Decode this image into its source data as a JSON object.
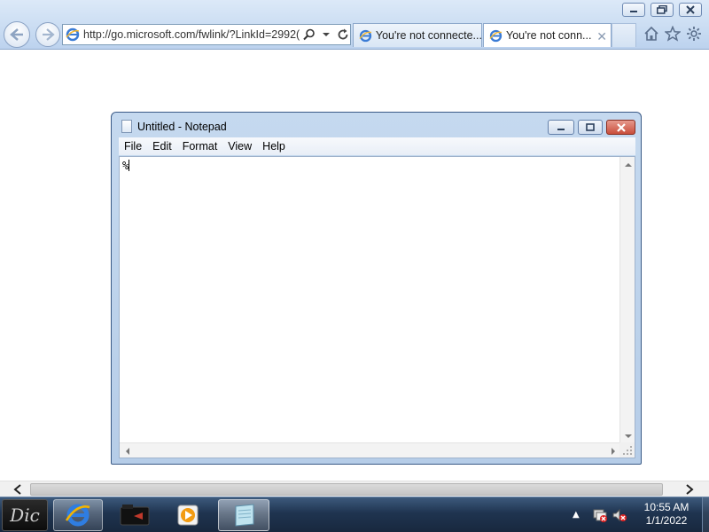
{
  "browser": {
    "address_url": "http://go.microsoft.com/fwlink/?LinkId=2992(",
    "tabs": [
      {
        "label": "You're not connecte..."
      },
      {
        "label": "You're not conn..."
      }
    ],
    "tab_close_glyph": "✕"
  },
  "notepad": {
    "title": "Untitled - Notepad",
    "menu": [
      "File",
      "Edit",
      "Format",
      "View",
      "Help"
    ],
    "content": "%"
  },
  "taskbar": {
    "clock_time": "10:55 AM",
    "clock_date": "1/1/2022",
    "start_label": "Dic"
  },
  "colors": {
    "ie_accent": "#3a7bd5",
    "close_red": "#c94f3c",
    "taskbar_bg": "#1f3450"
  }
}
